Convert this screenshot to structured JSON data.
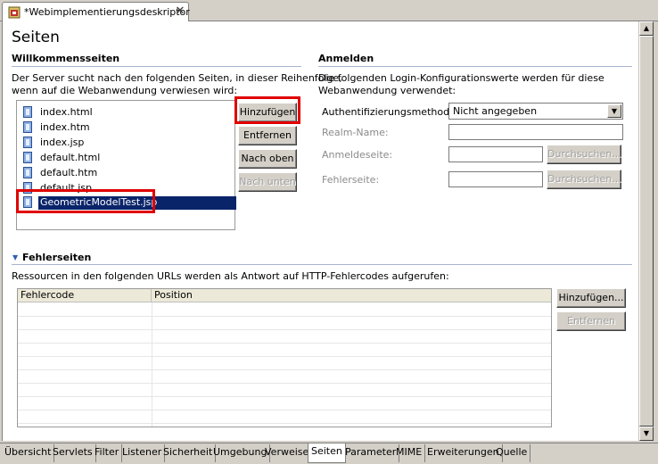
{
  "editor_tab": {
    "title": "*Webimplementierungsdeskriptor",
    "close_glyph": "✕",
    "icon": "web-descriptor-icon"
  },
  "page": {
    "title": "Seiten"
  },
  "welcome": {
    "heading": "Willkommensseiten",
    "description_line1": "Der Server sucht nach den folgenden Seiten, in dieser Reihenfolge,",
    "description_line2": "wenn auf die Webanwendung verwiesen wird:",
    "items": [
      {
        "label": "index.html",
        "icon": "jsp-file-icon"
      },
      {
        "label": "index.htm",
        "icon": "jsp-file-icon"
      },
      {
        "label": "index.jsp",
        "icon": "jsp-file-icon"
      },
      {
        "label": "default.html",
        "icon": "jsp-file-icon"
      },
      {
        "label": "default.htm",
        "icon": "jsp-file-icon"
      },
      {
        "label": "default.jsp",
        "icon": "jsp-file-icon"
      },
      {
        "label": "GeometricModelTest.jsp",
        "icon": "jsp-file-icon",
        "selected": true
      }
    ],
    "buttons": {
      "add": "Hinzufügen",
      "remove": "Entfernen",
      "up": "Nach oben",
      "down": "Nach unten"
    }
  },
  "login": {
    "heading": "Anmelden",
    "description_line1": "Die folgenden Login-Konfigurationswerte werden für diese",
    "description_line2": "Webanwendung verwendet:",
    "auth_label": "Authentifizierungsmethode:",
    "auth_value": "Nicht angegeben",
    "realm_label": "Realm-Name:",
    "login_page_label": "Anmeldeseite:",
    "error_page_label": "Fehlerseite:",
    "browse_label": "Durchsuchen..."
  },
  "errors": {
    "heading": "Fehlerseiten",
    "description": "Ressourcen in den folgenden URLs werden als Antwort auf HTTP-Fehlercodes aufgerufen:",
    "col_code": "Fehlercode",
    "col_position": "Position",
    "add": "Hinzufügen...",
    "remove": "Entfernen"
  },
  "bottom_tabs": [
    "Übersicht",
    "Servlets",
    "Filter",
    "Listener",
    "Sicherheit",
    "Umgebung",
    "Verweise",
    "Seiten",
    "Parameter",
    "MIME",
    "Erweiterungen",
    "Quelle"
  ],
  "active_tab": "Seiten",
  "colors": {
    "selection": "#0a246a",
    "highlight_box": "#e00000",
    "section_rule": "#a8b4d0"
  }
}
